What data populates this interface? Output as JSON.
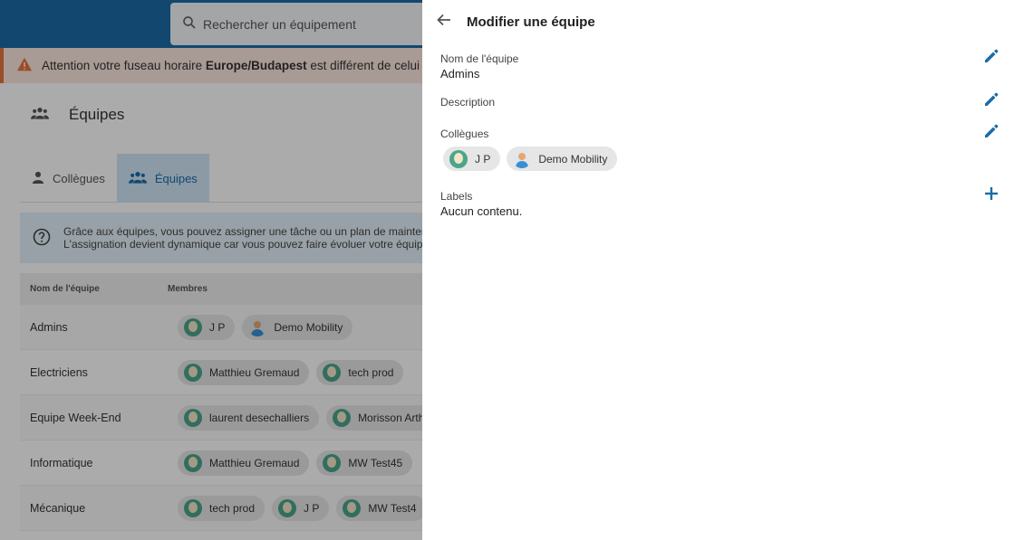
{
  "search": {
    "placeholder": "Rechercher un équipement"
  },
  "alert": {
    "prefix": "Attention votre fuseau horaire ",
    "timezone": "Europe/Budapest",
    "suffix": " est différent de celui d"
  },
  "page": {
    "title": "Équipes"
  },
  "tabs": [
    {
      "label": "Collègues",
      "icon": "person-icon"
    },
    {
      "label": "Équipes",
      "icon": "group-icon"
    }
  ],
  "info": {
    "line1": "Grâce aux équipes, vous pouvez assigner une tâche ou un plan de maintena",
    "line2": "L'assignation devient dynamique car vous pouvez faire évoluer votre équipe"
  },
  "table": {
    "headers": [
      "Nom de l'équipe",
      "Membres"
    ],
    "rows": [
      {
        "name": "Admins",
        "members": [
          "J P",
          "Demo Mobility"
        ]
      },
      {
        "name": "Electriciens",
        "members": [
          "Matthieu Gremaud",
          "tech prod"
        ]
      },
      {
        "name": "Equipe Week-End",
        "members": [
          "laurent desechalliers",
          "Morisson Arth"
        ]
      },
      {
        "name": "Informatique",
        "members": [
          "Matthieu Gremaud",
          "MW Test45"
        ]
      },
      {
        "name": "Mécanique",
        "members": [
          "tech prod",
          "J P",
          "MW Test4"
        ]
      }
    ]
  },
  "panel": {
    "title": "Modifier une équipe",
    "name_label": "Nom de l'équipe",
    "name_value": "Admins",
    "description_label": "Description",
    "colleagues_label": "Collègues",
    "colleagues": [
      "J P",
      "Demo Mobility"
    ],
    "labels_label": "Labels",
    "labels_value": "Aucun contenu."
  },
  "colors": {
    "primary": "#1b6ca8",
    "alert_bg": "#fbe6dd",
    "alert_icon": "#e8743b"
  }
}
